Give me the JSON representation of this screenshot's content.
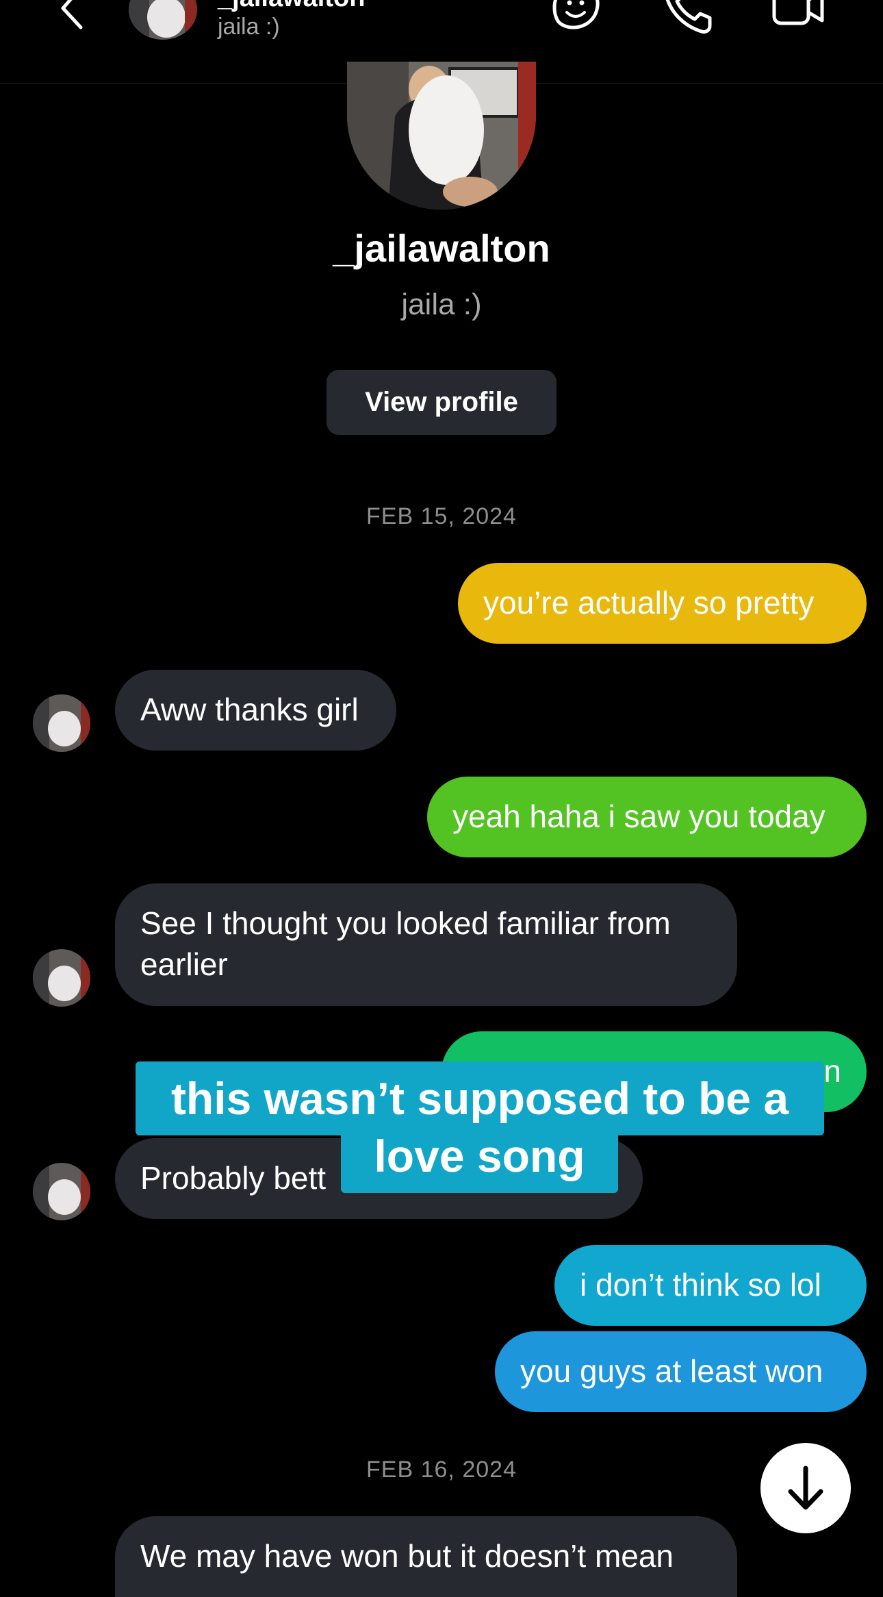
{
  "header": {
    "name": "_jailawalton",
    "subtitle": "jaila :)"
  },
  "profile": {
    "name": "_jailawalton",
    "subtitle": "jaila :)",
    "view_profile_label": "View profile"
  },
  "dates": [
    "FEB 15, 2024",
    "FEB 16, 2024"
  ],
  "messages": [
    {
      "from": "me",
      "text": "you’re actually so pretty",
      "color": "#e8b80c"
    },
    {
      "from": "them",
      "text": "Aww thanks girl"
    },
    {
      "from": "me",
      "text": "yeah haha i saw you today",
      "color": "#52c322"
    },
    {
      "from": "them",
      "text": "See I thought you looked familiar from earlier"
    },
    {
      "from": "me",
      "text": "n",
      "color": "#13bf63"
    },
    {
      "from": "them",
      "text": "Probably bett"
    },
    {
      "from": "me",
      "text": "i don’t think so lol",
      "color": "#12a7cf"
    },
    {
      "from": "me",
      "text": "you guys at least won",
      "color": "#1e96dc"
    },
    {
      "from": "them",
      "text": "We may have won but it doesn’t mean"
    }
  ],
  "caption": {
    "line1": "this wasn’t supposed to be a",
    "line2": "love song",
    "color": "#11a5c8"
  },
  "icons": [
    "back-arrow-icon",
    "sticker-icon",
    "phone-icon",
    "video-icon",
    "arrow-down-icon"
  ]
}
